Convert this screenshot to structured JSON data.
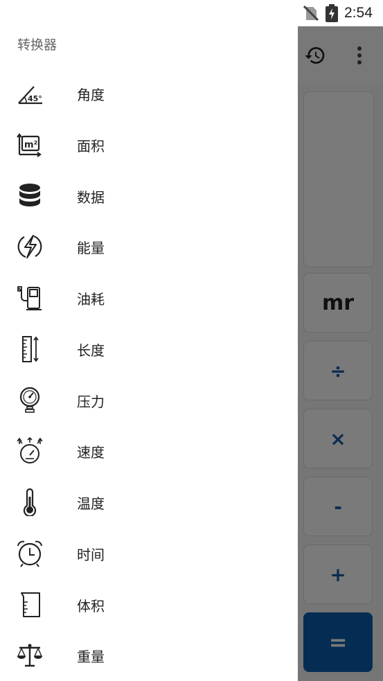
{
  "status_bar": {
    "time": "2:54"
  },
  "drawer": {
    "title": "转换器",
    "items": [
      {
        "label": "角度",
        "icon": "angle-icon"
      },
      {
        "label": "面积",
        "icon": "area-icon"
      },
      {
        "label": "数据",
        "icon": "database-icon"
      },
      {
        "label": "能量",
        "icon": "energy-icon"
      },
      {
        "label": "油耗",
        "icon": "fuel-pump-icon"
      },
      {
        "label": "长度",
        "icon": "ruler-icon"
      },
      {
        "label": "压力",
        "icon": "pressure-gauge-icon"
      },
      {
        "label": "速度",
        "icon": "speedometer-icon"
      },
      {
        "label": "温度",
        "icon": "thermometer-icon"
      },
      {
        "label": "时间",
        "icon": "alarm-clock-icon"
      },
      {
        "label": "体积",
        "icon": "beaker-icon"
      },
      {
        "label": "重量",
        "icon": "balance-scale-icon"
      }
    ]
  },
  "calculator": {
    "keys": [
      "mr",
      "÷",
      "×",
      "-",
      "+",
      "="
    ]
  }
}
